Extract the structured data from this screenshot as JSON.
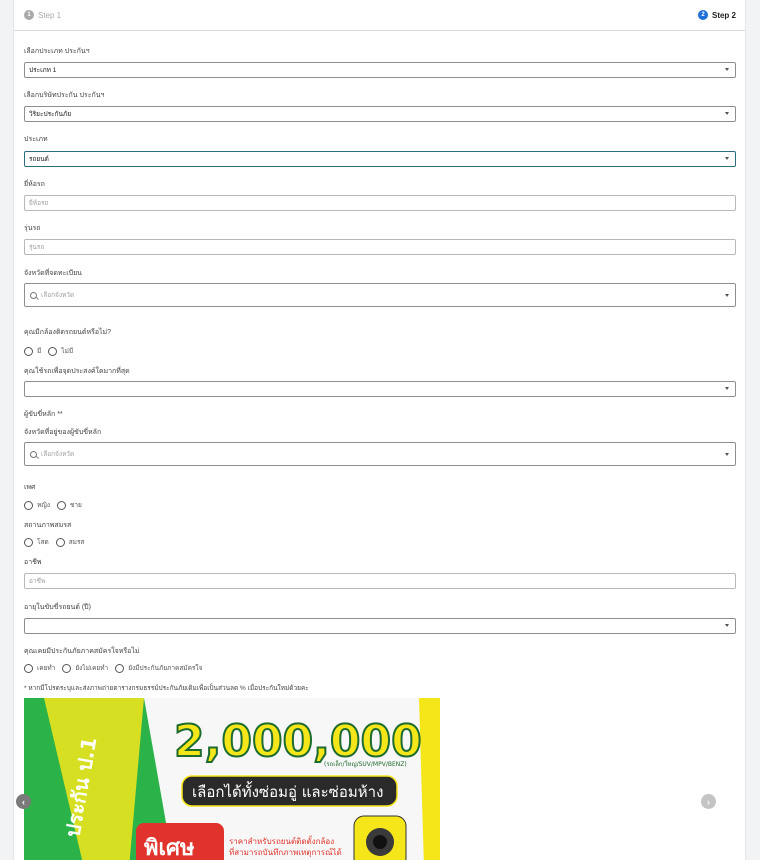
{
  "steps": [
    {
      "number": "1",
      "label": "Step 1"
    },
    {
      "number": "2",
      "label": "Step 2"
    }
  ],
  "fields": {
    "insurance_type": {
      "label": "เลือกประเภท ประกันฯ",
      "value": "ประเภท 1"
    },
    "insurer": {
      "label": "เลือกบริษัทประกัน ประกันฯ",
      "value": "วิริยะประกันภัย"
    },
    "car_type": {
      "label": "ประเภท",
      "value": "รถยนต์"
    },
    "brand": {
      "label": "ยี่ห้อรถ",
      "placeholder": "ยี่ห้อรถ"
    },
    "model": {
      "label": "รุ่นรถ",
      "placeholder": "รุ่นรถ"
    },
    "province": {
      "label": "จังหวัดที่จดทะเบียน",
      "placeholder": "เลือกจังหวัด"
    },
    "dashcam": {
      "label": "คุณมีกล้องติดรถยนต์หรือไม่?",
      "options": [
        "มี",
        "ไม่มี"
      ]
    },
    "usage": {
      "label": "คุณใช้รถเพื่อจุดประสงค์ใดมากที่สุด",
      "value": ""
    },
    "main_driver_heading": "ผู้ขับขี่หลัก **",
    "driver_province": {
      "label": "จังหวัดที่อยู่ของผู้ขับขี่หลัก",
      "placeholder": "เลือกจังหวัด"
    },
    "gender": {
      "label": "เพศ",
      "options": [
        "หญิง",
        "ชาย"
      ]
    },
    "marital": {
      "label": "สถานภาพสมรส",
      "options": [
        "โสด",
        "สมรส"
      ]
    },
    "occupation": {
      "label": "อาชีพ",
      "placeholder": "อาชีพ"
    },
    "driving_years": {
      "label": "อายุในขับขี่รถยนต์ (ปี)",
      "value": ""
    },
    "volunteer": {
      "label": "คุณเคยมีประกันภัยภาคสมัครใจหรือไม่",
      "options": [
        "เคยทำ",
        "ยังไม่เคยทำ",
        "ยังมีประกันภัยภาคสมัครใจ"
      ]
    },
    "footnote": "* หากมีโปรดระบุและส่งภาพถ่ายตารางกรมธรรม์ประกันภัยเดิมเพื่อเป็นส่วนลด % เมื่อประกันใหม่ด้วยคะ"
  },
  "banner": {
    "amount": "2,000,000",
    "vehicle_note": "(รถเล็ก/ใหญ่/SUV/MPV/BENZ)",
    "headline": "เลือกได้ทั้งซ่อมอู่ และซ่อมห้าง",
    "vertical_text": "ประกัน ป.1",
    "special": "พิเศษ",
    "promo_line1": "ราคาสำหรับรถยนต์ติดตั้งกล้อง",
    "promo_line2": "ที่สามารถบันทึกภาพเหตุการณ์ได้"
  },
  "carousel": {
    "prev_icon": "chevron-left-icon",
    "next_icon": "chevron-right-icon"
  },
  "colors": {
    "accent": "#1e6fd9",
    "focus_border": "#2b6e7e",
    "banner_green": "#1d8a3a",
    "banner_yellow": "#f5e61a"
  }
}
